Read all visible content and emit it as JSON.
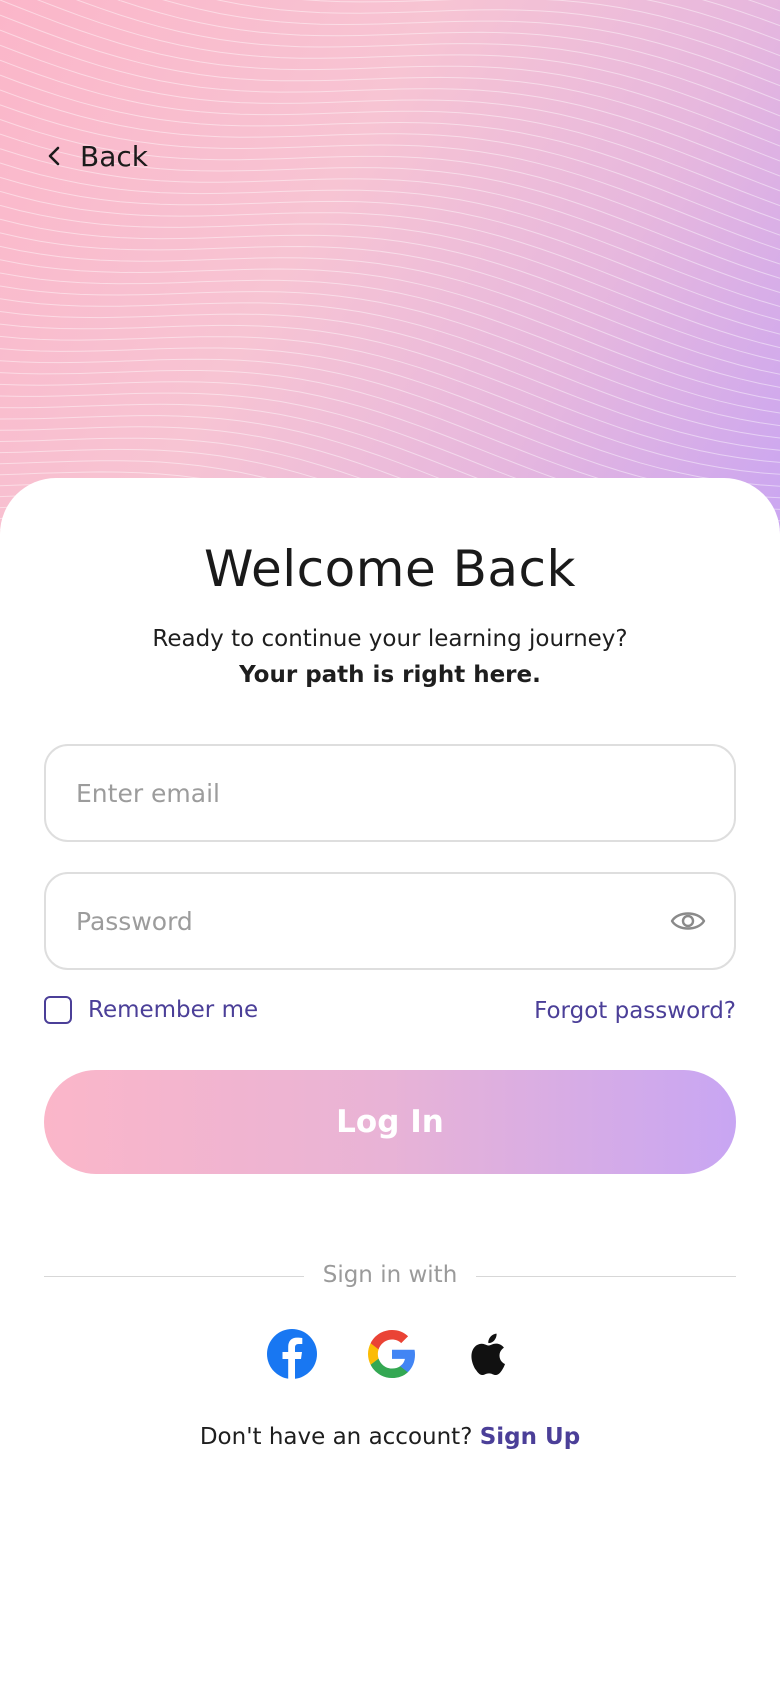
{
  "nav": {
    "back_label": "Back"
  },
  "welcome": {
    "title": "Welcome Back",
    "subtitle": "Ready to continue your learning journey?",
    "subtitle_strong": "Your path is right here."
  },
  "form": {
    "email_placeholder": "Enter email",
    "email_value": "",
    "password_placeholder": "Password",
    "password_value": "",
    "remember_label": "Remember me",
    "remember_checked": false,
    "forgot_label": "Forgot password?",
    "login_label": "Log In"
  },
  "social": {
    "divider_label": "Sign in with",
    "providers": [
      "facebook-icon",
      "google-icon",
      "apple-icon"
    ]
  },
  "footer": {
    "prompt": "Don't have an account? ",
    "signup_label": "Sign Up"
  },
  "colors": {
    "accent": "#4b3f98",
    "gradient_start": "#fbb6c9",
    "gradient_end": "#c8a6f3",
    "facebook": "#1877f2"
  }
}
